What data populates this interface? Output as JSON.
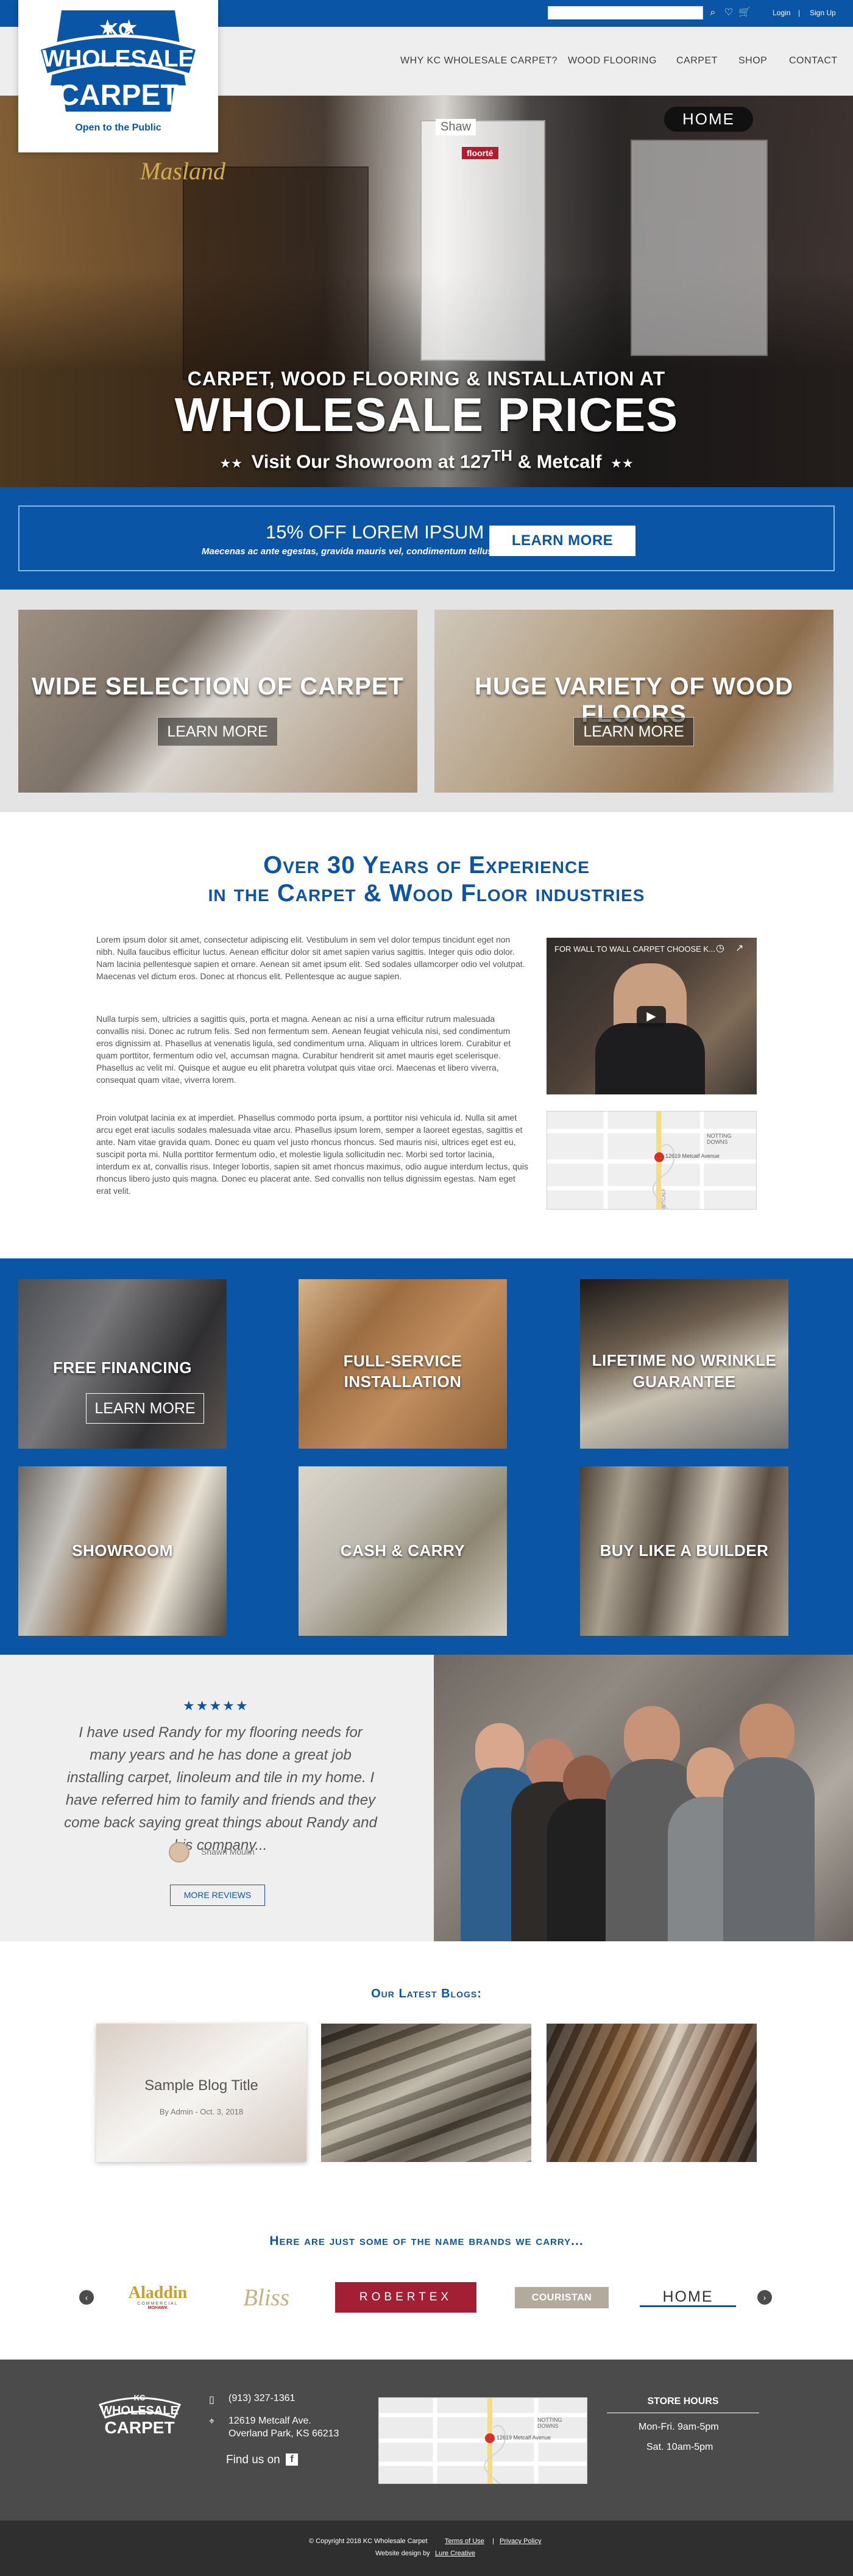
{
  "colors": {
    "brand_blue": "#0a55a5",
    "nav_bg": "#eeeeee",
    "footer_bg": "#4b4b4b",
    "footer_bottom_bg": "#2f2f2f"
  },
  "top_bar": {
    "search_placeholder": "",
    "icons": [
      "search-icon",
      "heart-icon",
      "cart-icon"
    ],
    "login": "Login",
    "separator": "|",
    "signup": "Sign Up"
  },
  "logo": {
    "kc": "KC",
    "line1": "WHOLESALE",
    "line2": "CARPET",
    "tagline": "Open to the Public"
  },
  "nav": {
    "items": [
      {
        "label": "WHY KC WHOLESALE CARPET?"
      },
      {
        "label": "WOOD FLOORING"
      },
      {
        "label": "CARPET"
      },
      {
        "label": "SHOP"
      },
      {
        "label": "CONTACT"
      }
    ]
  },
  "hero": {
    "line1": "CARPET, WOOD FLOORING & INSTALLATION AT",
    "line2": "WHOLESALE PRICES",
    "line3_prefix": "Visit Our Showroom at 127",
    "line3_sup": "TH",
    "line3_suffix": " & Metcalf",
    "brand_signs": [
      "Masland",
      "Shaw",
      "floorté",
      "HOME"
    ]
  },
  "promo": {
    "title": "15% OFF LOREM IPSUM",
    "subtitle": "Maecenas ac ante egestas, gravida mauris vel, condimentum tellus.",
    "button": "LEARN MORE"
  },
  "features": [
    {
      "title": "WIDE SELECTION OF CARPET",
      "button": "LEARN MORE"
    },
    {
      "title": "HUGE VARIETY OF WOOD FLOORS",
      "button": "LEARN MORE"
    }
  ],
  "intro": {
    "title_line1": "Over 30 Years of Experience",
    "title_line2": "in the Carpet & Wood Floor industries",
    "paragraphs": [
      "Lorem ipsum dolor sit amet, consectetur adipiscing elit. Vestibulum in sem vel dolor tempus tincidunt eget non nibh. Nulla faucibus efficitur luctus. Aenean efficitur dolor sit amet sapien varius sagittis. Integer quis odio dolor. Nam lacinia pellentesque sapien et ornare. Aenean sit amet ipsum elit. Sed sodales ullamcorper odio vel volutpat. Maecenas vel dictum eros. Donec at rhoncus elit. Pellentesque ac augue sapien.",
      "Nulla turpis sem, ultricies a sagittis quis, porta et magna. Aenean ac nisi a urna efficitur rutrum malesuada convallis nisi. Donec ac rutrum felis. Sed non fermentum sem. Aenean feugiat vehicula nisi, sed condimentum eros dignissim at. Phasellus at venenatis ligula, sed condimentum urna. Aliquam in ultrices lorem. Curabitur et quam porttitor, fermentum odio vel, accumsan magna. Curabitur hendrerit sit amet mauris eget scelerisque. Phasellus ac velit mi. Quisque et augue eu elit pharetra volutpat quis vitae orci. Maecenas et libero viverra, consequat quam vitae, viverra lorem.",
      "Proin volutpat lacinia ex at imperdiet. Phasellus commodo porta ipsum, a porttitor nisi vehicula id. Nulla sit amet arcu eget erat iaculis sodales malesuada vitae arcu. Phasellus ipsum lorem, semper a laoreet egestas, sagittis et ante. Nam vitae gravida quam. Donec eu quam vel justo rhoncus rhoncus. Sed mauris nisi, ultrices eget est eu, suscipit porta mi. Nulla porttitor fermentum odio, et molestie ligula sollicitudin nec. Morbi sed tortor lacinia, interdum ex at, convallis risus. Integer lobortis, sapien sit amet rhoncus maximus, odio augue interdum lectus, quis rhoncus libero justo quis magna. Donec eu placerat ante. Sed convallis non tellus dignissim egestas. Nam eget erat velit."
    ],
    "video_title": "FOR WALL TO WALL CARPET CHOOSE K...",
    "map_label": "12619 Metcalf Avenue",
    "map_road": "METCALF",
    "map_area": "NOTTING DOWNS"
  },
  "services": [
    {
      "title": "FREE FINANCING",
      "button": "LEARN MORE"
    },
    {
      "title_line1": "FULL-SERVICE",
      "title_line2": "INSTALLATION"
    },
    {
      "title_line1": "LIFETIME NO WRINKLE",
      "title_line2": "GUARANTEE"
    },
    {
      "title": "SHOWROOM"
    },
    {
      "title": "CASH & CARRY"
    },
    {
      "title": "BUY LIKE A BUILDER"
    }
  ],
  "review": {
    "stars": "★★★★★",
    "text": "I have used Randy for my flooring needs for many years and he has done a great job installing carpet, linoleum and tile in my home. I have referred him to family and friends and they come back saying great things about Randy and his company...",
    "author": "Shawn Moulin",
    "button": "MORE REVIEWS"
  },
  "blogs": {
    "title": "Our Latest Blogs:",
    "featured_title": "Sample Blog Title",
    "featured_meta": "By Admin - Oct. 3, 2018"
  },
  "brands": {
    "title": "Here are just some of the name brands we carry...",
    "items": [
      {
        "name": "Aladdin",
        "sub": "COMMERCIAL",
        "maker": "MOHAWK"
      },
      {
        "name": "Bliss"
      },
      {
        "name": "ROBERTEX"
      },
      {
        "name": "COURISTAN"
      },
      {
        "name": "HOME"
      }
    ]
  },
  "footer": {
    "phone": "(913) 327-1361",
    "address_line1": "12619 Metcalf Ave.",
    "address_line2": "Overland Park, KS 66213",
    "find_us": "Find us on",
    "store_hours_title": "STORE HOURS",
    "hours_line1": "Mon-Fri. 9am-5pm",
    "hours_line2": "Sat. 10am-5pm",
    "copyright": "© Copyright 2018 KC Wholesale Carpet",
    "sep": "|",
    "terms": "Terms of Use",
    "privacy": "Privacy Policy",
    "design_prefix": "Website design by",
    "design_link": "Lure Creative"
  }
}
